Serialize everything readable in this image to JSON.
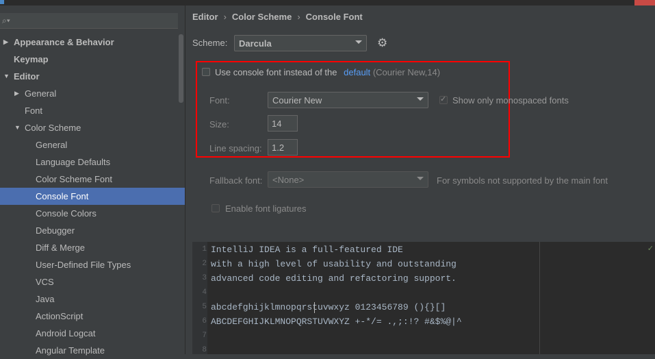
{
  "sidebar": {
    "search_placeholder": "",
    "items": [
      {
        "label": "Appearance & Behavior",
        "level": 0,
        "arrow": "▶",
        "bold": true
      },
      {
        "label": "Keymap",
        "level": 0,
        "arrow": "",
        "bold": true
      },
      {
        "label": "Editor",
        "level": 0,
        "arrow": "▼",
        "bold": true
      },
      {
        "label": "General",
        "level": 1,
        "arrow": "▶",
        "bold": false
      },
      {
        "label": "Font",
        "level": 1,
        "arrow": "",
        "bold": false
      },
      {
        "label": "Color Scheme",
        "level": 1,
        "arrow": "▼",
        "bold": false
      },
      {
        "label": "General",
        "level": 2,
        "arrow": "",
        "bold": false
      },
      {
        "label": "Language Defaults",
        "level": 2,
        "arrow": "",
        "bold": false
      },
      {
        "label": "Color Scheme Font",
        "level": 2,
        "arrow": "",
        "bold": false
      },
      {
        "label": "Console Font",
        "level": 2,
        "arrow": "",
        "bold": false,
        "selected": true
      },
      {
        "label": "Console Colors",
        "level": 2,
        "arrow": "",
        "bold": false
      },
      {
        "label": "Debugger",
        "level": 2,
        "arrow": "",
        "bold": false
      },
      {
        "label": "Diff & Merge",
        "level": 2,
        "arrow": "",
        "bold": false
      },
      {
        "label": "User-Defined File Types",
        "level": 2,
        "arrow": "",
        "bold": false
      },
      {
        "label": "VCS",
        "level": 2,
        "arrow": "",
        "bold": false
      },
      {
        "label": "Java",
        "level": 2,
        "arrow": "",
        "bold": false
      },
      {
        "label": "ActionScript",
        "level": 2,
        "arrow": "",
        "bold": false
      },
      {
        "label": "Android Logcat",
        "level": 2,
        "arrow": "",
        "bold": false
      },
      {
        "label": "Angular Template",
        "level": 2,
        "arrow": "",
        "bold": false
      }
    ]
  },
  "breadcrumb": [
    "Editor",
    "Color Scheme",
    "Console Font"
  ],
  "scheme": {
    "label": "Scheme:",
    "value": "Darcula"
  },
  "console_font": {
    "use_console_font_label": "Use console font instead of the",
    "default_link": "default",
    "default_detail": "(Courier New,14)",
    "font_label": "Font:",
    "font_value": "Courier New",
    "monospaced_label": "Show only monospaced fonts",
    "size_label": "Size:",
    "size_value": "14",
    "line_spacing_label": "Line spacing:",
    "line_spacing_value": "1.2"
  },
  "fallback": {
    "label": "Fallback font:",
    "value": "<None>",
    "hint": "For symbols not supported by the main font"
  },
  "ligatures_label": "Enable font ligatures",
  "preview": {
    "lines": [
      {
        "num": "1",
        "text": "IntelliJ IDEA is a full-featured IDE"
      },
      {
        "num": "2",
        "text": "with a high level of usability and outstanding"
      },
      {
        "num": "3",
        "text": "advanced code editing and refactoring support."
      },
      {
        "num": "4",
        "text": ""
      },
      {
        "num": "5",
        "text": "abcdefghijklmnopqrstuvwxyz 0123456789 (){}[]"
      },
      {
        "num": "6",
        "text": "ABCDEFGHIJKLMNOPQRSTUVWXYZ +-*/= .,;:!? #&$%@|^"
      },
      {
        "num": "7",
        "text": ""
      },
      {
        "num": "8",
        "text": ""
      }
    ]
  },
  "colors": {
    "accent_selection": "#4b6eaf",
    "link": "#589df6",
    "highlight_box": "#ff0000"
  }
}
